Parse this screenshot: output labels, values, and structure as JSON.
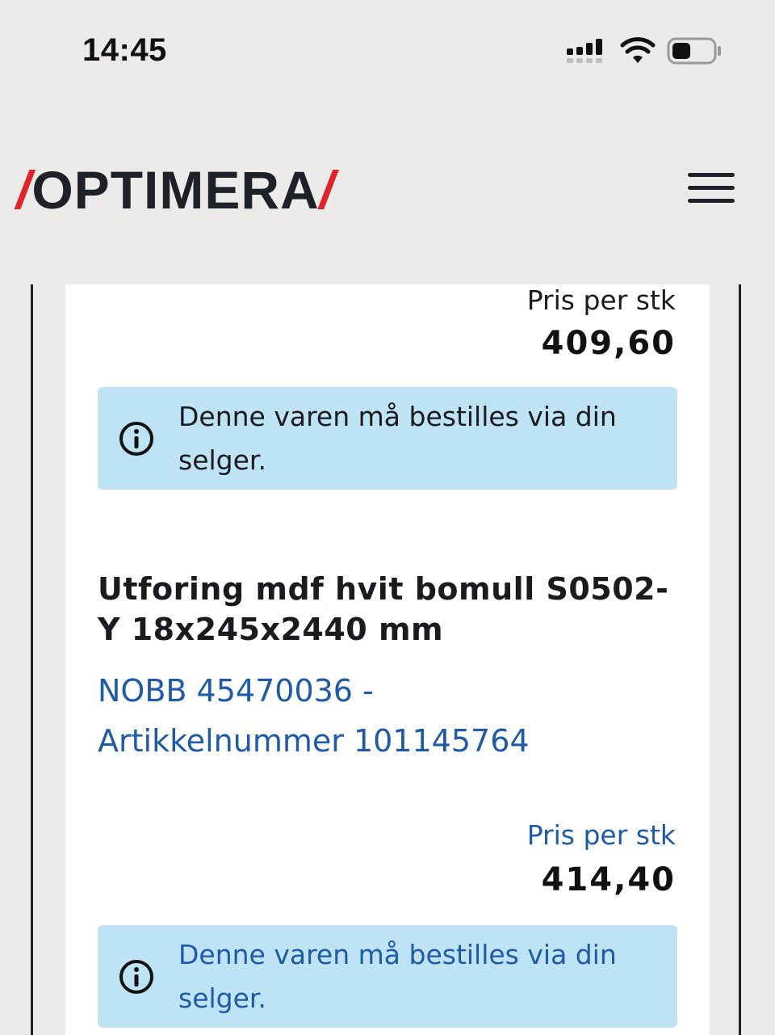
{
  "status_bar": {
    "time": "14:45"
  },
  "header": {
    "logo_text": "OPTIMERA",
    "logo_slash": "/",
    "menu_icon": "hamburger-menu-icon"
  },
  "products": [
    {
      "price_label": "Pris per stk",
      "price": "409,60",
      "notice": "Denne varen må bestilles via din selger."
    },
    {
      "title": "Utforing mdf hvit bomull S0502-Y 18x245x2440 mm",
      "meta_line1": "NOBB 45470036 -",
      "meta_line2": "Artikkelnummer 101145764",
      "price_label": "Pris per stk",
      "price": "414,40",
      "notice": "Denne varen må bestilles via din selger."
    }
  ],
  "colors": {
    "brand_red": "#e0242b",
    "brand_dark": "#1e2228",
    "link_blue": "#1f5aa8",
    "info_bg": "#bde3f5",
    "page_bg": "#ecebea"
  }
}
